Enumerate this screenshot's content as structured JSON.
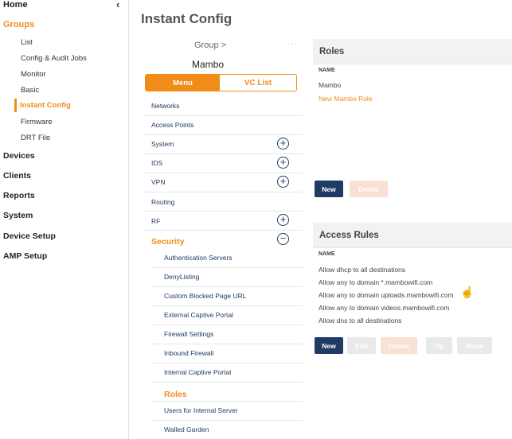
{
  "sidebar": {
    "home": "Home",
    "groups": "Groups",
    "group_items": [
      "List",
      "Config & Audit Jobs",
      "Monitor",
      "Basic",
      "Instant Config",
      "Firmware",
      "DRT File"
    ],
    "main_items": [
      "Devices",
      "Clients",
      "Reports",
      "System",
      "Device Setup",
      "AMP Setup"
    ],
    "collapse_glyph": "‹"
  },
  "page": {
    "title": "Instant Config"
  },
  "nav_panel": {
    "group_label": "Group >",
    "dots": "···",
    "group_name": "Mambo",
    "segment": {
      "menu": "Menu",
      "vc_list": "VC List"
    },
    "items": [
      "Networks",
      "Access Points",
      "System",
      "IDS",
      "VPN",
      "Routing",
      "RF"
    ],
    "security_title": "Security",
    "security_items": [
      "Authentication Servers",
      "DenyListing",
      "Custom Blocked Page URL",
      "External Captive Portal",
      "Firewall Settings",
      "Inbound Firewall",
      "Internal Captive Portal"
    ],
    "roles_title": "Roles",
    "roles_items": [
      "Users for Internal Server",
      "Walled Garden"
    ]
  },
  "roles_panel": {
    "title": "Roles",
    "col_name": "NAME",
    "rows": [
      "Mambo",
      "New Mambo Role"
    ],
    "new_button": "New",
    "delete_button": "Delete"
  },
  "access_panel": {
    "title": "Access Rules",
    "col_name": "NAME",
    "rows": [
      "Allow dhcp to all destinations",
      "Allow any to domain *.mambowifi.com",
      "Allow any to domain uploads.mambowifi.com",
      "Allow any to domain videos.mambowifi.com",
      "Allow dns to all destinations"
    ],
    "buttons": {
      "new": "New",
      "edit": "Edit",
      "delete": "Delete",
      "up": "Up",
      "down": "Down"
    }
  },
  "colors": {
    "accent": "#f28c18",
    "navy": "#1f3b63"
  }
}
